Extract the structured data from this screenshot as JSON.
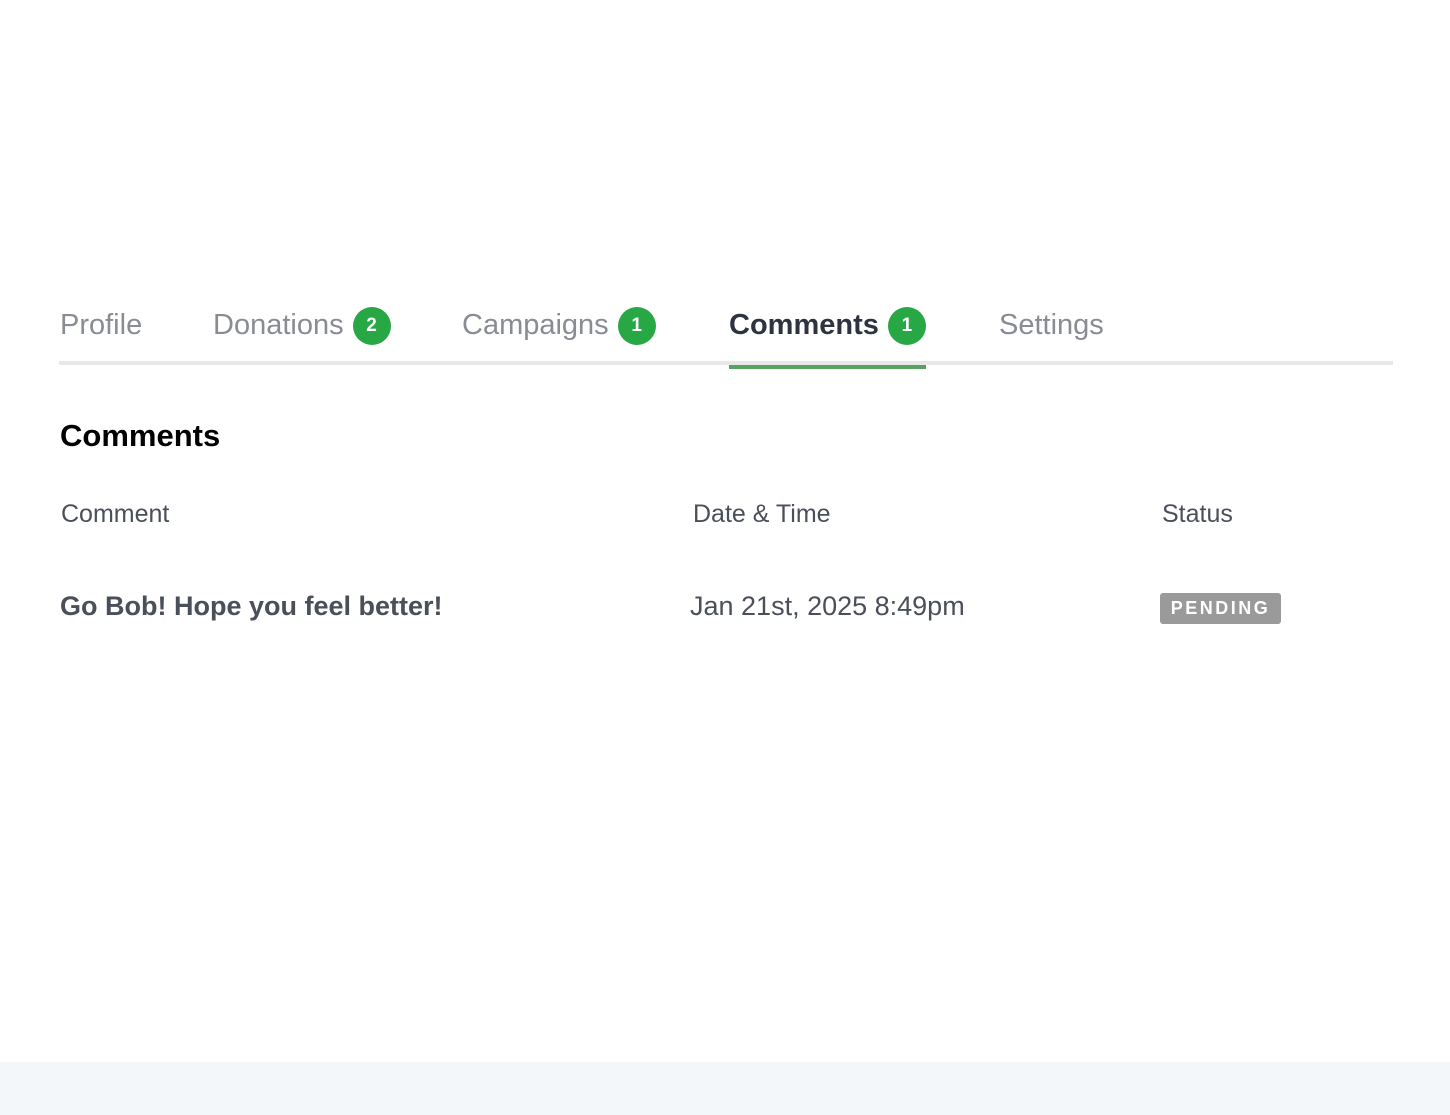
{
  "tabs": [
    {
      "label": "Profile",
      "badge": null
    },
    {
      "label": "Donations",
      "badge": "2"
    },
    {
      "label": "Campaigns",
      "badge": "1"
    },
    {
      "label": "Comments",
      "badge": "1",
      "active": true
    },
    {
      "label": "Settings",
      "badge": null
    }
  ],
  "section": {
    "title": "Comments"
  },
  "table": {
    "headers": [
      "Comment",
      "Date & Time",
      "Status"
    ],
    "rows": [
      {
        "comment": "Go Bob! Hope you feel better!",
        "datetime": "Jan 21st, 2025 8:49pm",
        "status": "PENDING"
      }
    ]
  },
  "colors": {
    "badge": "#28a745",
    "active_underline": "#5aa15e",
    "status_pending": "#9a9a9a",
    "footer_band": "#f4f7f9"
  }
}
